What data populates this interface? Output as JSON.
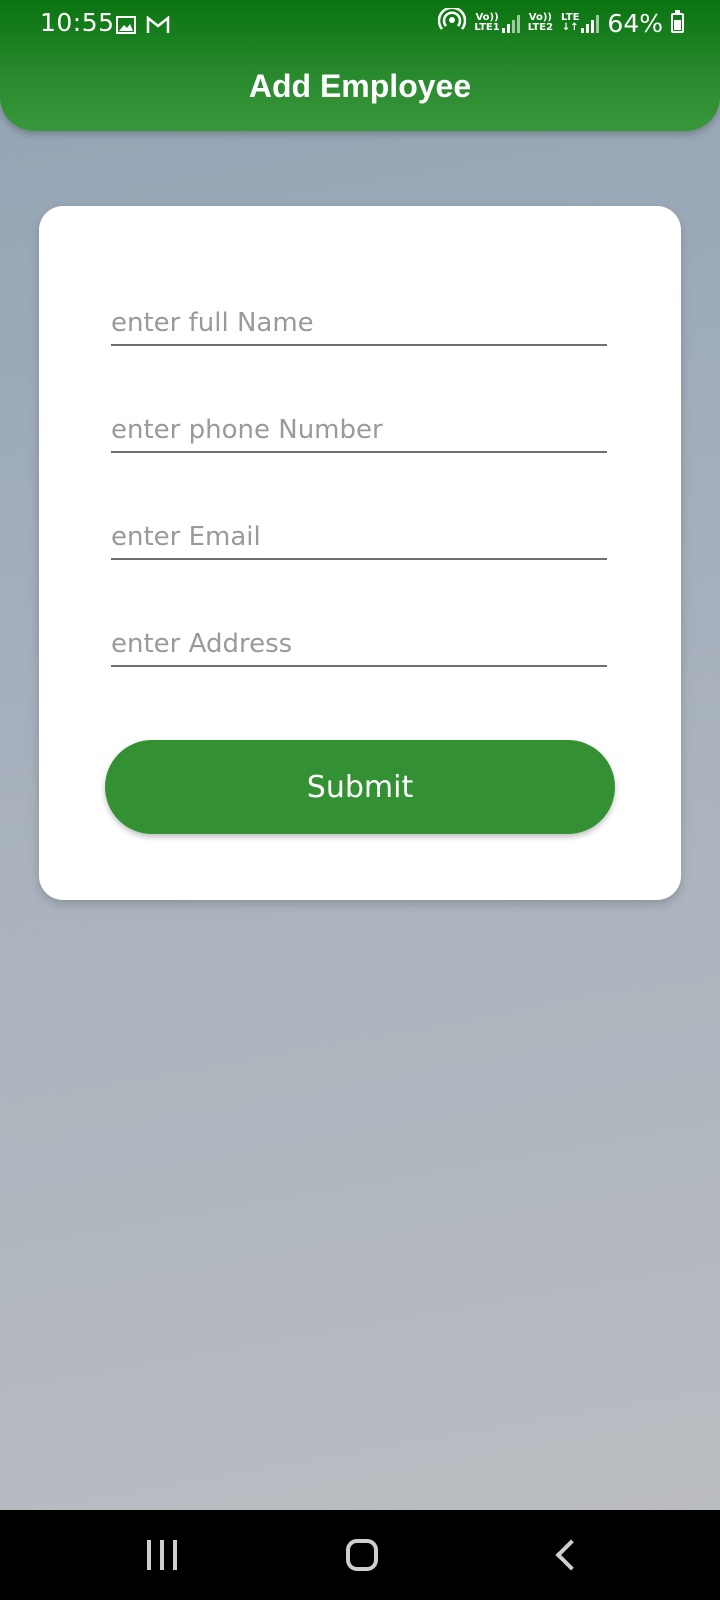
{
  "status_bar": {
    "time": "10:55",
    "left_icons": [
      "image-icon",
      "gmail-icon"
    ],
    "right_icons": [
      "hotspot-icon",
      "volte-lte1-signal-icon",
      "volte-lte2-signal-icon",
      "lte-signal-icon",
      "battery-icon"
    ],
    "lte1_label_top": "Vo))",
    "lte1_label_bottom": "LTE1",
    "lte2_label_top": "Vo))",
    "lte2_label_bottom": "LTE2",
    "lte_label": "LTE",
    "battery_percent": "64%"
  },
  "header": {
    "title": "Add Employee",
    "color": "#2a8a2e"
  },
  "form": {
    "fields": [
      {
        "placeholder": "enter full Name",
        "value": ""
      },
      {
        "placeholder": "enter phone Number",
        "value": ""
      },
      {
        "placeholder": "enter Email",
        "value": ""
      },
      {
        "placeholder": "enter Address",
        "value": ""
      }
    ],
    "submit_label": "Submit",
    "submit_color": "#339133"
  },
  "nav_bar": {
    "buttons": [
      "recents-icon",
      "home-icon",
      "back-icon"
    ]
  }
}
